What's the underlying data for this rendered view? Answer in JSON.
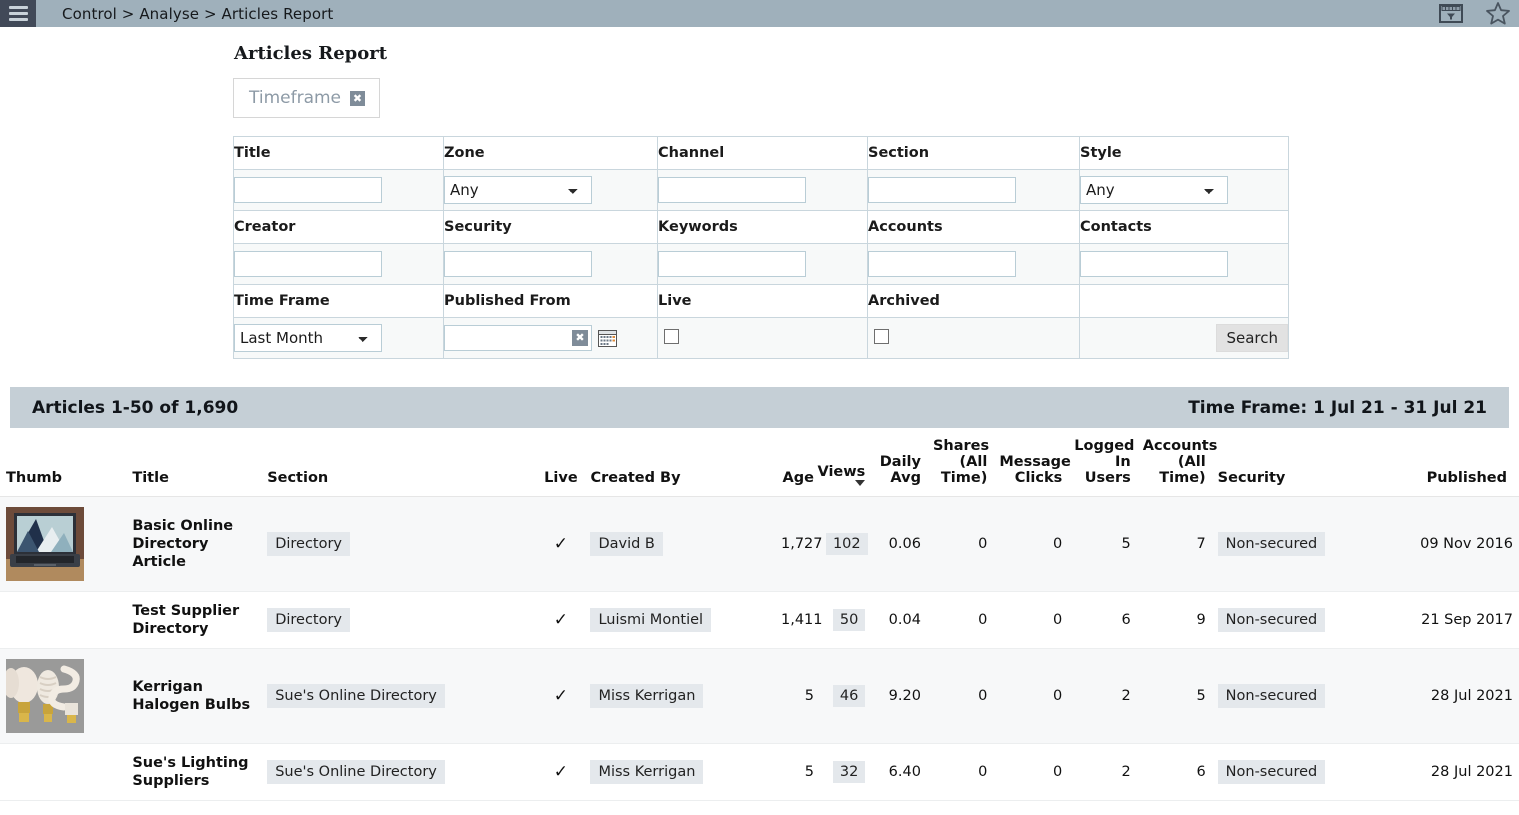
{
  "topbar": {
    "menu_icon": "hamburger-menu-icon",
    "breadcrumb": "Control > Analyse > Articles Report",
    "filter_icon": "filter-window-icon",
    "favourite_icon": "star-icon",
    "bar_color": "#9fb0bb",
    "menu_color": "#414958"
  },
  "page": {
    "title": "Articles Report",
    "timeframe_chip": {
      "label": "Timeframe",
      "close_label": "✖"
    }
  },
  "search_form": {
    "row1_labels": [
      "Title",
      "Zone",
      "Channel",
      "Section",
      "Style"
    ],
    "row2_labels": [
      "Creator",
      "Security",
      "Keywords",
      "Accounts",
      "Contacts"
    ],
    "row3_labels": [
      "Time Frame",
      "Published From",
      "Live",
      "Archived",
      ""
    ],
    "fields": {
      "title": {
        "value": "",
        "placeholder": ""
      },
      "zone": {
        "value": "Any",
        "options": [
          "Any"
        ]
      },
      "channel": {
        "value": "",
        "placeholder": ""
      },
      "section": {
        "value": "",
        "placeholder": ""
      },
      "style": {
        "value": "Any",
        "options": [
          "Any"
        ]
      },
      "creator": {
        "value": "",
        "placeholder": ""
      },
      "security": {
        "value": "",
        "placeholder": ""
      },
      "keywords": {
        "value": "",
        "placeholder": ""
      },
      "accounts": {
        "value": "",
        "placeholder": ""
      },
      "contacts": {
        "value": "",
        "placeholder": ""
      },
      "time_frame": {
        "value": "Last Month",
        "options": [
          "Last Month"
        ]
      },
      "published_from": {
        "value": "",
        "clear_label": "✖",
        "calendar_icon": "calendar-icon"
      },
      "live_checked": false,
      "archived_checked": false
    },
    "search_button": "Search"
  },
  "results_banner": {
    "count_text": "Articles 1-50 of 1,690",
    "time_frame_text": "Time Frame: 1 Jul 21 - 31 Jul 21",
    "background": "#c5cfd6"
  },
  "results_table": {
    "columns": [
      {
        "key": "thumb",
        "label": "Thumb",
        "align": "left"
      },
      {
        "key": "title",
        "label": "Title",
        "align": "left"
      },
      {
        "key": "section",
        "label": "Section",
        "align": "left"
      },
      {
        "key": "live",
        "label": "Live",
        "align": "center"
      },
      {
        "key": "created_by",
        "label": "Created By",
        "align": "left"
      },
      {
        "key": "age",
        "label": "Age",
        "align": "right"
      },
      {
        "key": "views",
        "label": "Views",
        "align": "right",
        "sorted": "desc"
      },
      {
        "key": "daily_avg",
        "label": "Daily Avg",
        "align": "right"
      },
      {
        "key": "shares",
        "label": "Shares (All Time)",
        "align": "right"
      },
      {
        "key": "message_clicks",
        "label": "Message Clicks",
        "align": "right"
      },
      {
        "key": "logged_in_users",
        "label": "Logged In Users",
        "align": "right"
      },
      {
        "key": "accounts",
        "label": "Accounts (All Time)",
        "align": "right"
      },
      {
        "key": "security",
        "label": "Security",
        "align": "left"
      },
      {
        "key": "published",
        "label": "Published",
        "align": "right"
      }
    ],
    "rows": [
      {
        "thumb": "laptop-thumbnail",
        "has_thumb": true,
        "title": "Basic Online Directory Article",
        "section": "Directory",
        "live": "✓",
        "created_by": "David B",
        "age": "1,727",
        "views": "102",
        "daily_avg": "0.06",
        "shares": "0",
        "message_clicks": "0",
        "logged_in_users": "5",
        "accounts": "7",
        "security": "Non-secured",
        "published": "09 Nov 2016"
      },
      {
        "thumb": "",
        "has_thumb": false,
        "title": "Test Supplier Directory",
        "section": "Directory",
        "live": "✓",
        "created_by": "Luismi Montiel",
        "age": "1,411",
        "views": "50",
        "daily_avg": "0.04",
        "shares": "0",
        "message_clicks": "0",
        "logged_in_users": "6",
        "accounts": "9",
        "security": "Non-secured",
        "published": "21 Sep 2017"
      },
      {
        "thumb": "lightbulbs-thumbnail",
        "has_thumb": true,
        "title": "Kerrigan Halogen Bulbs",
        "section": "Sue's Online Directory",
        "live": "✓",
        "created_by": "Miss Kerrigan",
        "age": "5",
        "views": "46",
        "daily_avg": "9.20",
        "shares": "0",
        "message_clicks": "0",
        "logged_in_users": "2",
        "accounts": "5",
        "security": "Non-secured",
        "published": "28 Jul 2021"
      },
      {
        "thumb": "",
        "has_thumb": false,
        "title": "Sue's Lighting Suppliers",
        "section": "Sue's Online Directory",
        "live": "✓",
        "created_by": "Miss Kerrigan",
        "age": "5",
        "views": "32",
        "daily_avg": "6.40",
        "shares": "0",
        "message_clicks": "0",
        "logged_in_users": "2",
        "accounts": "6",
        "security": "Non-secured",
        "published": "28 Jul 2021"
      }
    ]
  }
}
